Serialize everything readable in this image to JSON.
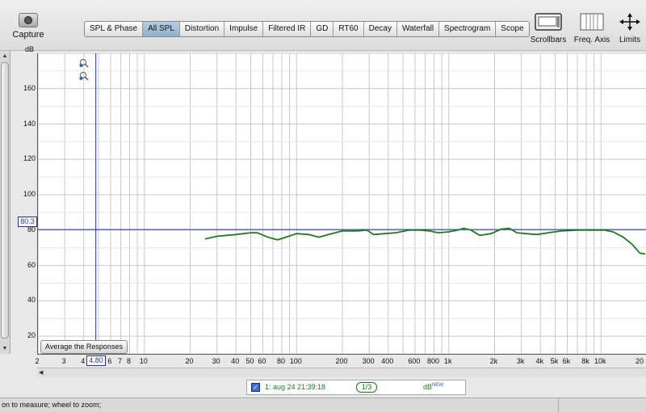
{
  "toolbar": {
    "capture_label": "Capture",
    "tabs": [
      "SPL & Phase",
      "All SPL",
      "Distortion",
      "Impulse",
      "Filtered IR",
      "GD",
      "RT60",
      "Decay",
      "Waterfall",
      "Spectrogram",
      "Scope"
    ],
    "active_tab": "All SPL",
    "scrollbars_label": "Scrollbars",
    "freq_axis_label": "Freq. Axis",
    "limits_label": "Limits"
  },
  "plot": {
    "y_unit": "dB",
    "y_cursor_value": "80.3",
    "x_cursor_value": "4.80",
    "average_button_label": "Average the Responses"
  },
  "legend": {
    "checked": true,
    "measurement_name": "1: aug 24 21:39:18",
    "smoothing": "1/3",
    "unit": "dB",
    "unit_sup": "NEW"
  },
  "status_text": "on to measure; wheel to zoom;",
  "colors": {
    "trace": "#1e7a1e",
    "cursor": "#2233aa",
    "active_tab": "#9db9d6"
  },
  "chart_data": {
    "type": "line",
    "x_scale": "log",
    "xlim": [
      2,
      20000
    ],
    "ylim": [
      10,
      180
    ],
    "y_ticks": [
      20,
      40,
      60,
      80,
      100,
      120,
      140,
      160
    ],
    "x_tick_labels": [
      {
        "v": 2,
        "t": "2"
      },
      {
        "v": 3,
        "t": "3"
      },
      {
        "v": 4,
        "t": "4"
      },
      {
        "v": 6,
        "t": "6"
      },
      {
        "v": 7,
        "t": "7"
      },
      {
        "v": 8,
        "t": "8"
      },
      {
        "v": 10,
        "t": "10"
      },
      {
        "v": 20,
        "t": "20"
      },
      {
        "v": 30,
        "t": "30"
      },
      {
        "v": 40,
        "t": "40"
      },
      {
        "v": 50,
        "t": "50"
      },
      {
        "v": 60,
        "t": "60"
      },
      {
        "v": 80,
        "t": "80"
      },
      {
        "v": 100,
        "t": "100"
      },
      {
        "v": 200,
        "t": "200"
      },
      {
        "v": 300,
        "t": "300"
      },
      {
        "v": 400,
        "t": "400"
      },
      {
        "v": 600,
        "t": "600"
      },
      {
        "v": 800,
        "t": "800"
      },
      {
        "v": 1000,
        "t": "1k"
      },
      {
        "v": 2000,
        "t": "2k"
      },
      {
        "v": 3000,
        "t": "3k"
      },
      {
        "v": 4000,
        "t": "4k"
      },
      {
        "v": 5000,
        "t": "5k"
      },
      {
        "v": 6000,
        "t": "6k"
      },
      {
        "v": 8000,
        "t": "8k"
      },
      {
        "v": 10000,
        "t": "10k"
      },
      {
        "v": 20000,
        "t": "20"
      }
    ],
    "cursor_x": 4.8,
    "cursor_y": 80.3,
    "series": [
      {
        "x": [
          25,
          30,
          40,
          50,
          55,
          65,
          75,
          85,
          100,
          120,
          140,
          170,
          200,
          250,
          290,
          320,
          380,
          450,
          550,
          650,
          750,
          850,
          1000,
          1150,
          1250,
          1400,
          1600,
          1900,
          2200,
          2500,
          2800,
          3200,
          3800,
          4500,
          5500,
          7000,
          9000,
          10500,
          12000,
          14000,
          16000,
          18000,
          19500
        ],
        "y": [
          75,
          76.5,
          77.5,
          78.5,
          78.5,
          76,
          74.5,
          76,
          78,
          77.5,
          76,
          78,
          79.5,
          79.5,
          80,
          77.5,
          78,
          78.5,
          80,
          80,
          79.5,
          78.5,
          79,
          80,
          81,
          80,
          77,
          78,
          80.5,
          81,
          78.5,
          78,
          77.5,
          78.5,
          79.5,
          80,
          80,
          80,
          79,
          76,
          72,
          67,
          66.5
        ]
      }
    ]
  }
}
